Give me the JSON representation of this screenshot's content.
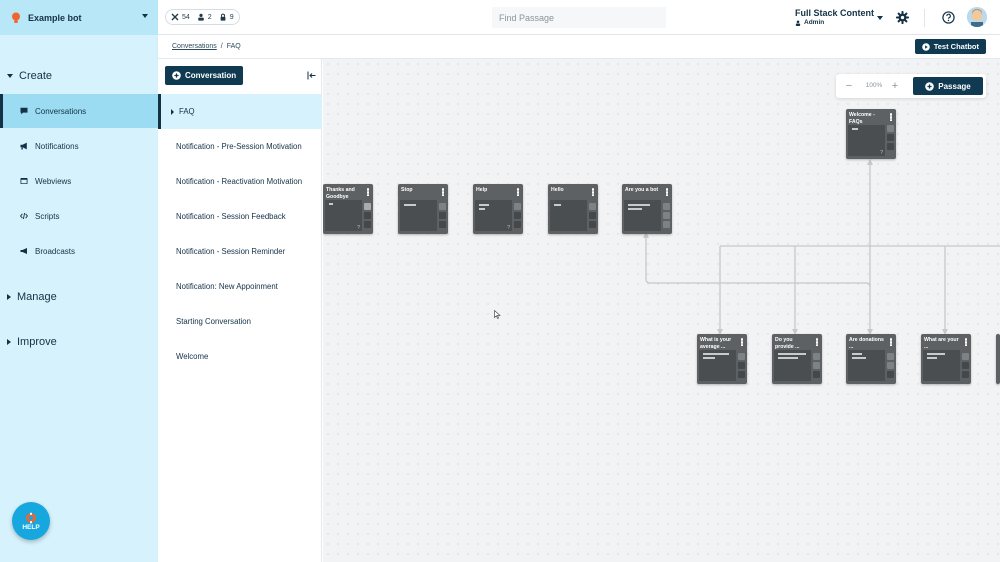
{
  "topbar": {
    "bot_name": "Example bot",
    "stats": [
      {
        "icon": "tools-icon",
        "value": "54"
      },
      {
        "icon": "users-icon",
        "value": "2"
      },
      {
        "icon": "lock-icon",
        "value": "9"
      }
    ],
    "search_placeholder": "Find Passage",
    "org_name": "Full Stack Content",
    "role": "Admin"
  },
  "leftnav": {
    "sections": [
      {
        "label": "Create",
        "expanded": true
      },
      {
        "label": "Manage",
        "expanded": false
      },
      {
        "label": "Improve",
        "expanded": false
      }
    ],
    "items": [
      {
        "label": "Conversations",
        "icon": "chat-icon",
        "active": true
      },
      {
        "label": "Notifications",
        "icon": "bullhorn-icon"
      },
      {
        "label": "Webviews",
        "icon": "window-icon"
      },
      {
        "label": "Scripts",
        "icon": "code-icon"
      },
      {
        "label": "Broadcasts",
        "icon": "megaphone-icon"
      }
    ],
    "help_label": "HELP"
  },
  "breadcrumb": {
    "parent": "Conversations",
    "separator": "/",
    "current": "FAQ"
  },
  "test_chatbot_label": "Test Chatbot",
  "passage_list": {
    "add_label": "Conversation",
    "items": [
      {
        "label": "FAQ",
        "active": true
      },
      {
        "label": "Notification - Pre-Session Motivation"
      },
      {
        "label": "Notification - Reactivation Motivation"
      },
      {
        "label": "Notification - Session Feedback"
      },
      {
        "label": "Notification - Session Reminder"
      },
      {
        "label": "Notification: New Appoinment"
      },
      {
        "label": "Starting Conversation"
      },
      {
        "label": "Welcome"
      }
    ]
  },
  "canvas": {
    "zoom_minus": "−",
    "zoom_level": "100%",
    "zoom_plus": "+",
    "passage_label": "Passage",
    "nodes": [
      {
        "title": "Welcome - FAQs"
      },
      {
        "title": "Thanks and Goodbye"
      },
      {
        "title": "Stop"
      },
      {
        "title": "Help"
      },
      {
        "title": "Hello"
      },
      {
        "title": "Are you a bot"
      },
      {
        "title": "What is your average ..."
      },
      {
        "title": "Do you provide ..."
      },
      {
        "title": "Are donations ..."
      },
      {
        "title": "What are your ..."
      }
    ],
    "node_footer_mark": "?"
  },
  "colors": {
    "brand_dark": "#0f3a52",
    "nav_bg": "#d6f2fc",
    "nav_active": "#9cdcf2",
    "node_bg": "#5d6164",
    "help_fab": "#16a7df"
  }
}
